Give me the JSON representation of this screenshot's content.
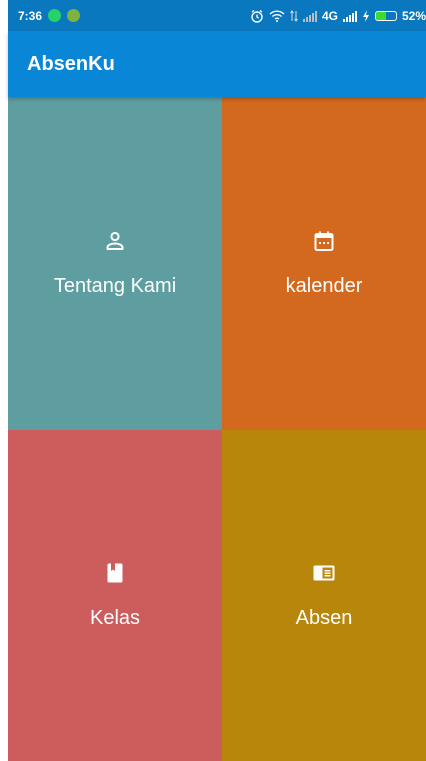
{
  "status_bar": {
    "time": "7:36",
    "network": "4G",
    "battery": "52%",
    "battery_level": 0.52,
    "icons": [
      "whatsapp-icon",
      "app-notification-icon",
      "alarm-icon",
      "wifi-icon",
      "signal-icon",
      "charging-icon",
      "battery-icon"
    ]
  },
  "app_bar": {
    "title": "AbsenKu",
    "color": "#0a86d6"
  },
  "menu": {
    "items": [
      {
        "label": "Tentang Kami",
        "icon": "person-icon",
        "color": "#5f9ea0"
      },
      {
        "label": "kalender",
        "icon": "calendar-icon",
        "color": "#d2691e"
      },
      {
        "label": "Kelas",
        "icon": "book-icon",
        "color": "#cd5c5c"
      },
      {
        "label": "Absen",
        "icon": "id-card-icon",
        "color": "#b8860b"
      }
    ]
  }
}
